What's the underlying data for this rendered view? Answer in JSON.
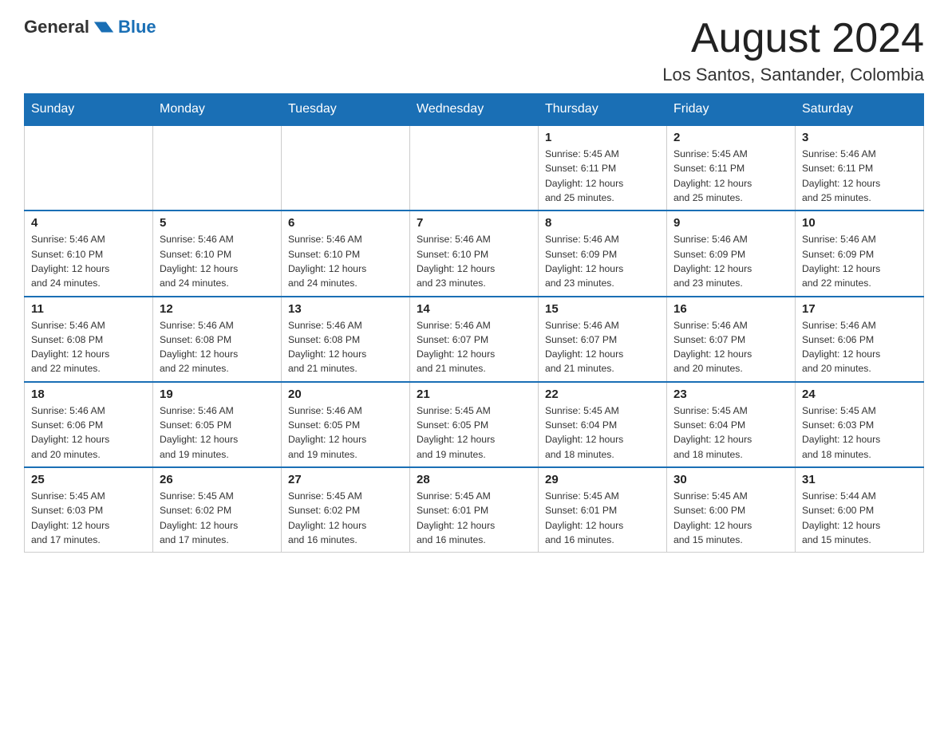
{
  "logo": {
    "text_general": "General",
    "text_blue": "Blue",
    "arrow_color": "#1a6fb5"
  },
  "title": {
    "month_year": "August 2024",
    "location": "Los Santos, Santander, Colombia"
  },
  "header_color": "#1a6fb5",
  "days_of_week": [
    "Sunday",
    "Monday",
    "Tuesday",
    "Wednesday",
    "Thursday",
    "Friday",
    "Saturday"
  ],
  "weeks": [
    {
      "cells": [
        {
          "day": "",
          "info": ""
        },
        {
          "day": "",
          "info": ""
        },
        {
          "day": "",
          "info": ""
        },
        {
          "day": "",
          "info": ""
        },
        {
          "day": "1",
          "info": "Sunrise: 5:45 AM\nSunset: 6:11 PM\nDaylight: 12 hours\nand 25 minutes."
        },
        {
          "day": "2",
          "info": "Sunrise: 5:45 AM\nSunset: 6:11 PM\nDaylight: 12 hours\nand 25 minutes."
        },
        {
          "day": "3",
          "info": "Sunrise: 5:46 AM\nSunset: 6:11 PM\nDaylight: 12 hours\nand 25 minutes."
        }
      ]
    },
    {
      "cells": [
        {
          "day": "4",
          "info": "Sunrise: 5:46 AM\nSunset: 6:10 PM\nDaylight: 12 hours\nand 24 minutes."
        },
        {
          "day": "5",
          "info": "Sunrise: 5:46 AM\nSunset: 6:10 PM\nDaylight: 12 hours\nand 24 minutes."
        },
        {
          "day": "6",
          "info": "Sunrise: 5:46 AM\nSunset: 6:10 PM\nDaylight: 12 hours\nand 24 minutes."
        },
        {
          "day": "7",
          "info": "Sunrise: 5:46 AM\nSunset: 6:10 PM\nDaylight: 12 hours\nand 23 minutes."
        },
        {
          "day": "8",
          "info": "Sunrise: 5:46 AM\nSunset: 6:09 PM\nDaylight: 12 hours\nand 23 minutes."
        },
        {
          "day": "9",
          "info": "Sunrise: 5:46 AM\nSunset: 6:09 PM\nDaylight: 12 hours\nand 23 minutes."
        },
        {
          "day": "10",
          "info": "Sunrise: 5:46 AM\nSunset: 6:09 PM\nDaylight: 12 hours\nand 22 minutes."
        }
      ]
    },
    {
      "cells": [
        {
          "day": "11",
          "info": "Sunrise: 5:46 AM\nSunset: 6:08 PM\nDaylight: 12 hours\nand 22 minutes."
        },
        {
          "day": "12",
          "info": "Sunrise: 5:46 AM\nSunset: 6:08 PM\nDaylight: 12 hours\nand 22 minutes."
        },
        {
          "day": "13",
          "info": "Sunrise: 5:46 AM\nSunset: 6:08 PM\nDaylight: 12 hours\nand 21 minutes."
        },
        {
          "day": "14",
          "info": "Sunrise: 5:46 AM\nSunset: 6:07 PM\nDaylight: 12 hours\nand 21 minutes."
        },
        {
          "day": "15",
          "info": "Sunrise: 5:46 AM\nSunset: 6:07 PM\nDaylight: 12 hours\nand 21 minutes."
        },
        {
          "day": "16",
          "info": "Sunrise: 5:46 AM\nSunset: 6:07 PM\nDaylight: 12 hours\nand 20 minutes."
        },
        {
          "day": "17",
          "info": "Sunrise: 5:46 AM\nSunset: 6:06 PM\nDaylight: 12 hours\nand 20 minutes."
        }
      ]
    },
    {
      "cells": [
        {
          "day": "18",
          "info": "Sunrise: 5:46 AM\nSunset: 6:06 PM\nDaylight: 12 hours\nand 20 minutes."
        },
        {
          "day": "19",
          "info": "Sunrise: 5:46 AM\nSunset: 6:05 PM\nDaylight: 12 hours\nand 19 minutes."
        },
        {
          "day": "20",
          "info": "Sunrise: 5:46 AM\nSunset: 6:05 PM\nDaylight: 12 hours\nand 19 minutes."
        },
        {
          "day": "21",
          "info": "Sunrise: 5:45 AM\nSunset: 6:05 PM\nDaylight: 12 hours\nand 19 minutes."
        },
        {
          "day": "22",
          "info": "Sunrise: 5:45 AM\nSunset: 6:04 PM\nDaylight: 12 hours\nand 18 minutes."
        },
        {
          "day": "23",
          "info": "Sunrise: 5:45 AM\nSunset: 6:04 PM\nDaylight: 12 hours\nand 18 minutes."
        },
        {
          "day": "24",
          "info": "Sunrise: 5:45 AM\nSunset: 6:03 PM\nDaylight: 12 hours\nand 18 minutes."
        }
      ]
    },
    {
      "cells": [
        {
          "day": "25",
          "info": "Sunrise: 5:45 AM\nSunset: 6:03 PM\nDaylight: 12 hours\nand 17 minutes."
        },
        {
          "day": "26",
          "info": "Sunrise: 5:45 AM\nSunset: 6:02 PM\nDaylight: 12 hours\nand 17 minutes."
        },
        {
          "day": "27",
          "info": "Sunrise: 5:45 AM\nSunset: 6:02 PM\nDaylight: 12 hours\nand 16 minutes."
        },
        {
          "day": "28",
          "info": "Sunrise: 5:45 AM\nSunset: 6:01 PM\nDaylight: 12 hours\nand 16 minutes."
        },
        {
          "day": "29",
          "info": "Sunrise: 5:45 AM\nSunset: 6:01 PM\nDaylight: 12 hours\nand 16 minutes."
        },
        {
          "day": "30",
          "info": "Sunrise: 5:45 AM\nSunset: 6:00 PM\nDaylight: 12 hours\nand 15 minutes."
        },
        {
          "day": "31",
          "info": "Sunrise: 5:44 AM\nSunset: 6:00 PM\nDaylight: 12 hours\nand 15 minutes."
        }
      ]
    }
  ]
}
